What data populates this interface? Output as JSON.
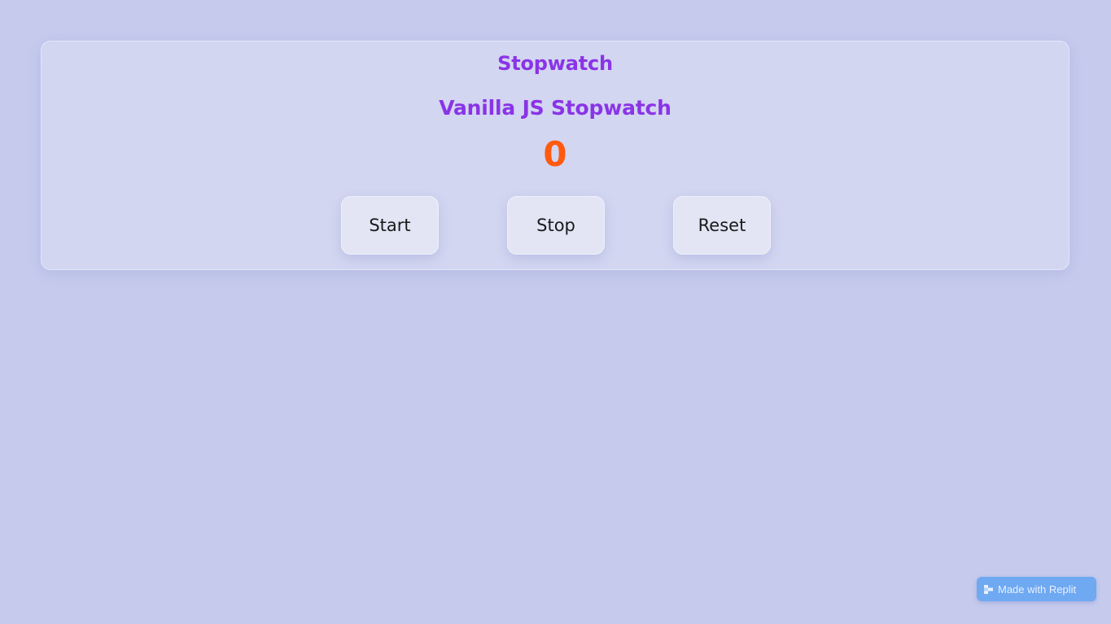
{
  "card": {
    "title": "Stopwatch",
    "subtitle": "Vanilla JS Stopwatch",
    "counter": "0"
  },
  "buttons": {
    "start_label": "Start",
    "stop_label": "Stop",
    "reset_label": "Reset"
  },
  "badge": {
    "label": "Made with Replit",
    "icon": "replit-logo-icon"
  },
  "colors": {
    "background": "#c6cbee",
    "title": "#8a34e6",
    "counter": "#ff5a0f",
    "badge": "#6fa9f2"
  }
}
